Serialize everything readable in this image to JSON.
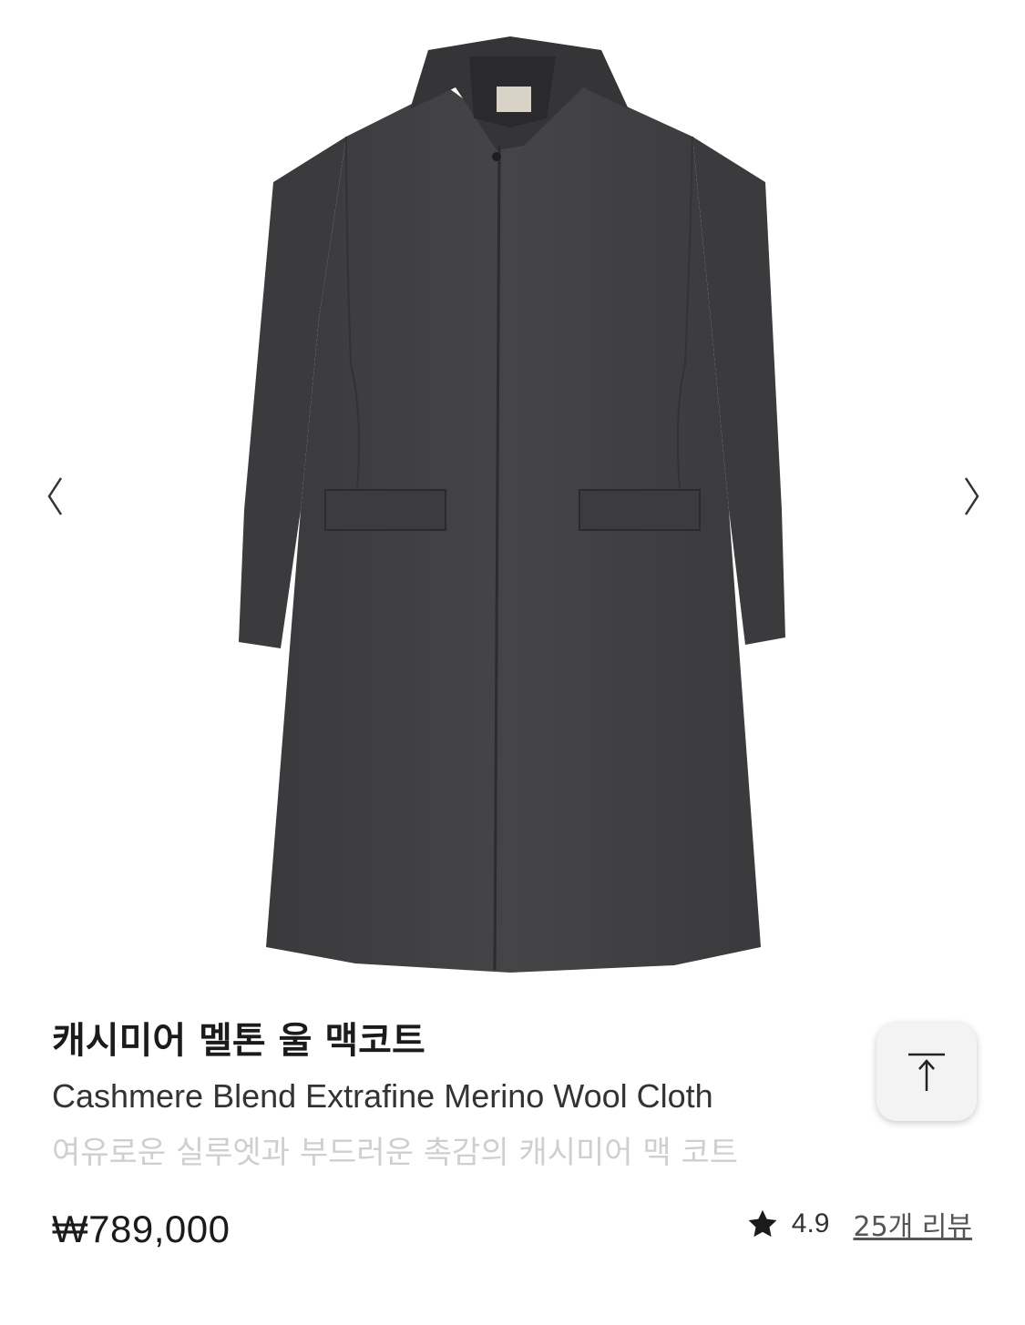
{
  "gallery": {
    "image_alt": "Charcoal wool mac coat",
    "prev_icon": "chevron-left-icon",
    "next_icon": "chevron-right-icon"
  },
  "product": {
    "title": "캐시미어 멜톤 울 맥코트",
    "subtitle": "Cashmere Blend Extrafine Merino Wool Cloth",
    "description": "여유로운 실루엣과 부드러운 촉감의 캐시미어 맥 코트",
    "price": "₩789,000",
    "rating": "4.9",
    "review_link": "25개 리뷰"
  },
  "scroll_top": {
    "icon": "arrow-up-to-top-icon"
  },
  "colors": {
    "coat": "#3f3f41",
    "coat_dark": "#2b2b2d",
    "description_text": "#cfcfcf"
  }
}
